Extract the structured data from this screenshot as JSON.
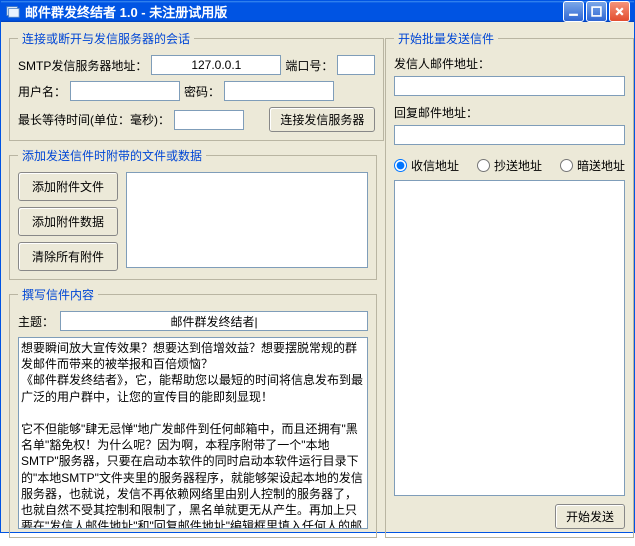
{
  "title": "邮件群发终结者  1.0 -  未注册试用版",
  "conn": {
    "legend": "连接或断开与发信服务器的会话",
    "smtp_label": "SMTP发信服务器地址：",
    "smtp_value": "127.0.0.1",
    "port_label": "端口号：",
    "port_value": "",
    "user_label": "用户名：",
    "user_value": "",
    "pass_label": "密码：",
    "pass_value": "",
    "timeout_label": "最长等待时间(单位：毫秒)：",
    "timeout_value": "",
    "connect_btn": "连接发信服务器"
  },
  "attach": {
    "legend": "添加发送信件时附带的文件或数据",
    "add_file": "添加附件文件",
    "add_data": "添加附件数据",
    "clear": "清除所有附件"
  },
  "compose": {
    "legend": "撰写信件内容",
    "subject_label": "主题：",
    "subject_value": "邮件群发终结者|",
    "body": "想要瞬间放大宣传效果？想要达到倍增效益？想要摆脱常规的群发邮件而带来的被举报和百倍烦恼？\n《邮件群发终结者》，它，能帮助您以最短的时间将信息发布到最广泛的用户群中，让您的宣传目的能即刻显现！\n\n它不但能够\"肆无忌惮\"地广发邮件到任何邮箱中，而且还拥有\"黑名单\"豁免权！为什么呢？因为啊，本程序附带了一个\"本地SMTP\"服务器，只要在启动本软件的同时启动本软件运行目录下的\"本地SMTP\"文件夹里的服务器程序，就能够架设起本地的发信服务器，也就说，发信不再依赖网络里由别人控制的服务器了，也就自然不受其控制和限制了，黑名单就更无从产生。再加上只要在\"发信人邮件地址\"和\"回复邮件地址\"编辑框里填入任何人的邮址（虽然地址必须有效），[转移目标的邮箱服务器就会以为这邮件是\"发信人邮件地址\"或\"回复邮件地址\"里指明的地址发送过来的，因此就实现了\"转移视线和嫁祸于人\"的目的！(怎么样，奸诈不奸诈啊，呵呵。∩_∩)"
  },
  "send": {
    "legend": "开始批量发送信件",
    "from_label": "发信人邮件地址：",
    "from_value": "",
    "reply_label": "回复邮件地址：",
    "reply_value": "",
    "radio_to": "收信地址",
    "radio_cc": "抄送地址",
    "radio_bcc": "暗送地址",
    "send_btn": "开始发送"
  }
}
